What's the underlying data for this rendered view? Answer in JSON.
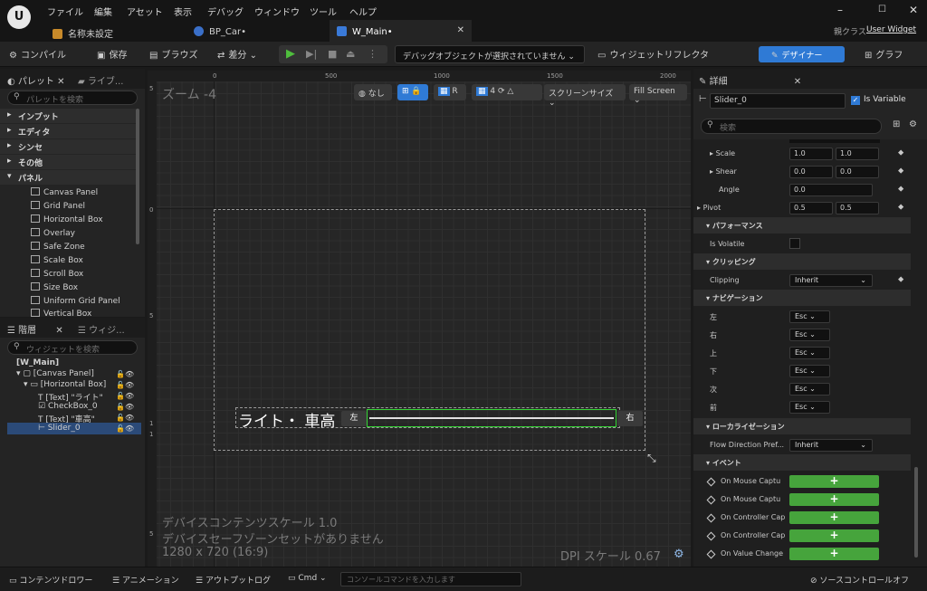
{
  "title_bar": {
    "menus": [
      "ファイル",
      "編集",
      "アセット",
      "表示",
      "デバッグ",
      "ウィンドウ",
      "ツール",
      "ヘルプ"
    ],
    "tabs": [
      "名称未設定",
      "BP_Car•",
      "W_Main•"
    ],
    "parent_class_label": "親クラス",
    "parent_class_value": "User Widget"
  },
  "toolbar": {
    "compile": "コンパイル",
    "save": "保存",
    "browse": "ブラウズ",
    "diff": "差分",
    "debug_object": "デバッグオブジェクトが選択されていません",
    "widget_reflector": "ウィジェットリフレクタ",
    "designer": "デザイナー",
    "graph": "グラフ"
  },
  "palette": {
    "tab1": "パレット",
    "tab2": "ライブ...",
    "search_placeholder": "パレットを検索",
    "categories": [
      "インプット",
      "エディタ",
      "シンセ",
      "その他",
      "パネル"
    ],
    "items": [
      "Canvas Panel",
      "Grid Panel",
      "Horizontal Box",
      "Overlay",
      "Safe Zone",
      "Scale Box",
      "Scroll Box",
      "Size Box",
      "Uniform Grid Panel",
      "Vertical Box"
    ]
  },
  "hierarchy": {
    "tab1": "階層",
    "tab2": "ウィジ...",
    "search_placeholder": "ウィジェットを検索",
    "nodes": [
      "[W_Main]",
      "[Canvas Panel]",
      "[Horizontal Box]",
      "[Text] \"ライト\"",
      "CheckBox_0",
      "[Text] \"車高\"",
      "Slider_0"
    ]
  },
  "viewport": {
    "zoom": "ズーム -4",
    "btn_none": "なし",
    "btn_r": "R",
    "btn_4": "4",
    "screen_size": "スクリーンサイズ",
    "fill_screen": "Fill Screen",
    "ruler_top": [
      "0",
      "500",
      "1000",
      "1500",
      "2000"
    ],
    "ruler_left": [
      "5",
      "0",
      "5",
      "1",
      "1",
      "5"
    ],
    "widget_text": "ライト・ 車高",
    "left_btn": "左",
    "right_btn": "右",
    "info1": "デバイスコンテンツスケール 1.0",
    "info2": "デバイスセーフゾーンセットがありません",
    "info3": "1280 x 720 (16:9)",
    "dpi": "DPI スケール 0.67"
  },
  "details": {
    "tab": "詳細",
    "name": "Slider_0",
    "is_variable": "Is Variable",
    "search_placeholder": "検索",
    "scale_label": "Scale",
    "scale_x": "1.0",
    "scale_y": "1.0",
    "shear_label": "Shear",
    "shear_x": "0.0",
    "shear_y": "0.0",
    "angle_label": "Angle",
    "angle": "0.0",
    "pivot_label": "Pivot",
    "pivot_x": "0.5",
    "pivot_y": "0.5",
    "section_performance": "パフォーマンス",
    "is_volatile": "Is Volatile",
    "section_clipping": "クリッピング",
    "clipping_label": "Clipping",
    "clipping_value": "Inherit",
    "section_navigation": "ナビゲーション",
    "nav": [
      {
        "label": "左",
        "value": "Esc"
      },
      {
        "label": "右",
        "value": "Esc"
      },
      {
        "label": "上",
        "value": "Esc"
      },
      {
        "label": "下",
        "value": "Esc"
      },
      {
        "label": "次",
        "value": "Esc"
      },
      {
        "label": "前",
        "value": "Esc"
      }
    ],
    "section_localization": "ローカライゼーション",
    "flow_label": "Flow Direction Pref...",
    "flow_value": "Inherit",
    "section_events": "イベント",
    "events": [
      "On Mouse Captu",
      "On Mouse Captu",
      "On Controller Cap",
      "On Controller Cap",
      "On Value Change"
    ]
  },
  "status_bar": {
    "content_drawer": "コンテンツドロワー",
    "animation": "アニメーション",
    "output_log": "アウトプットログ",
    "cmd": "Cmd",
    "console_placeholder": "コンソールコマンドを入力します",
    "source_control": "ソースコントロールオフ"
  }
}
